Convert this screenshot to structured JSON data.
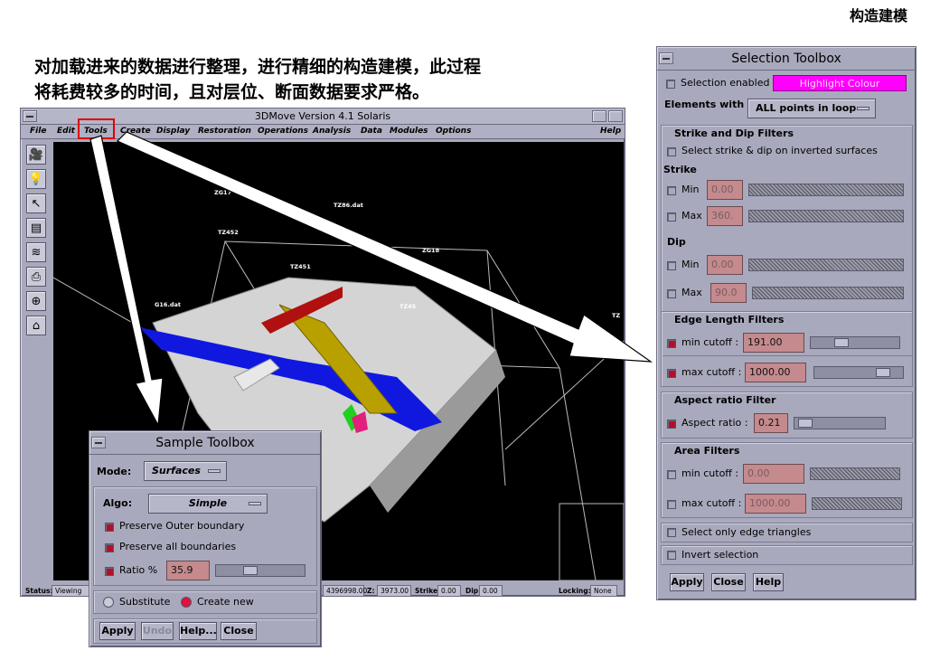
{
  "slide": {
    "corner_title": "构造建模",
    "description_line1": "对加载进来的数据进行整理，进行精细的构造建模，此过程",
    "description_line2": "将耗费较多的时间，且对层位、断面数据要求严格。"
  },
  "main_window": {
    "title": "3DMove Version 4.1 Solaris",
    "menu": [
      "File",
      "Edit",
      "Tools",
      "Create",
      "Display",
      "Restoration",
      "Operations",
      "Analysis",
      "Data",
      "Modules",
      "Options"
    ],
    "help_label": "Help",
    "viewport_labels": [
      "ZG17",
      "TZ86.dat",
      "TZ452",
      "ZG18",
      "TZ451",
      "TZ45",
      "G16.dat",
      "TZ"
    ],
    "toolbar_icons": [
      "camera-icon",
      "lightbulb-icon",
      "arrow-cursor-icon",
      "layers-icon",
      "stack-icon",
      "printer-icon",
      "crosshair-icon",
      "home-icon"
    ],
    "status": {
      "status_label": "Status:",
      "status_value": "Viewing",
      "y_value": "4396998.00",
      "z_label": "Z:",
      "z_value": "3973.00",
      "strike_label": "Strike:",
      "strike_value": "0.00",
      "dip_label": "Dip:",
      "dip_value": "0.00",
      "locking_label": "Locking:",
      "locking_value": "None"
    }
  },
  "selection_toolbox": {
    "title": "Selection Toolbox",
    "selection_enabled_label": "Selection enabled",
    "highlight_colour_label": "Highlight Colour",
    "highlight_color": "#ff00ff",
    "elements_with_label": "Elements with",
    "elements_with_value": "ALL points in loop",
    "strike_dip_filters": {
      "heading": "Strike and Dip Filters",
      "inverted_label": "Select strike & dip on inverted surfaces",
      "strike_label": "Strike",
      "strike_min_label": "Min",
      "strike_min_value": "0.00",
      "strike_max_label": "Max",
      "strike_max_value": "360.",
      "dip_label": "Dip",
      "dip_min_label": "Min",
      "dip_min_value": "0.00",
      "dip_max_label": "Max",
      "dip_max_value": "90.0"
    },
    "edge_length_filters": {
      "heading": "Edge Length Filters",
      "min_label": "min cutoff :",
      "min_value": "191.00",
      "max_label": "max cutoff :",
      "max_value": "1000.00"
    },
    "aspect_ratio_filter": {
      "heading": "Aspect ratio Filter",
      "label": "Aspect ratio :",
      "value": "0.21"
    },
    "area_filters": {
      "heading": "Area Filters",
      "min_label": "min cutoff :",
      "min_value": "0.00",
      "max_label": "max cutoff :",
      "max_value": "1000.00"
    },
    "edge_triangles_label": "Select only edge triangles",
    "invert_label": "Invert selection",
    "buttons": {
      "apply": "Apply",
      "close": "Close",
      "help": "Help"
    }
  },
  "sample_toolbox": {
    "title": "Sample Toolbox",
    "mode_label": "Mode:",
    "mode_value": "Surfaces",
    "algo_label": "Algo:",
    "algo_value": "Simple",
    "preserve_outer_label": "Preserve Outer boundary",
    "preserve_all_label": "Preserve all boundaries",
    "ratio_label": "Ratio %",
    "ratio_value": "35.9",
    "substitute_label": "Substitute",
    "create_new_label": "Create new",
    "buttons": {
      "apply": "Apply",
      "undo": "Undo",
      "help": "Help...",
      "close": "Close"
    }
  }
}
